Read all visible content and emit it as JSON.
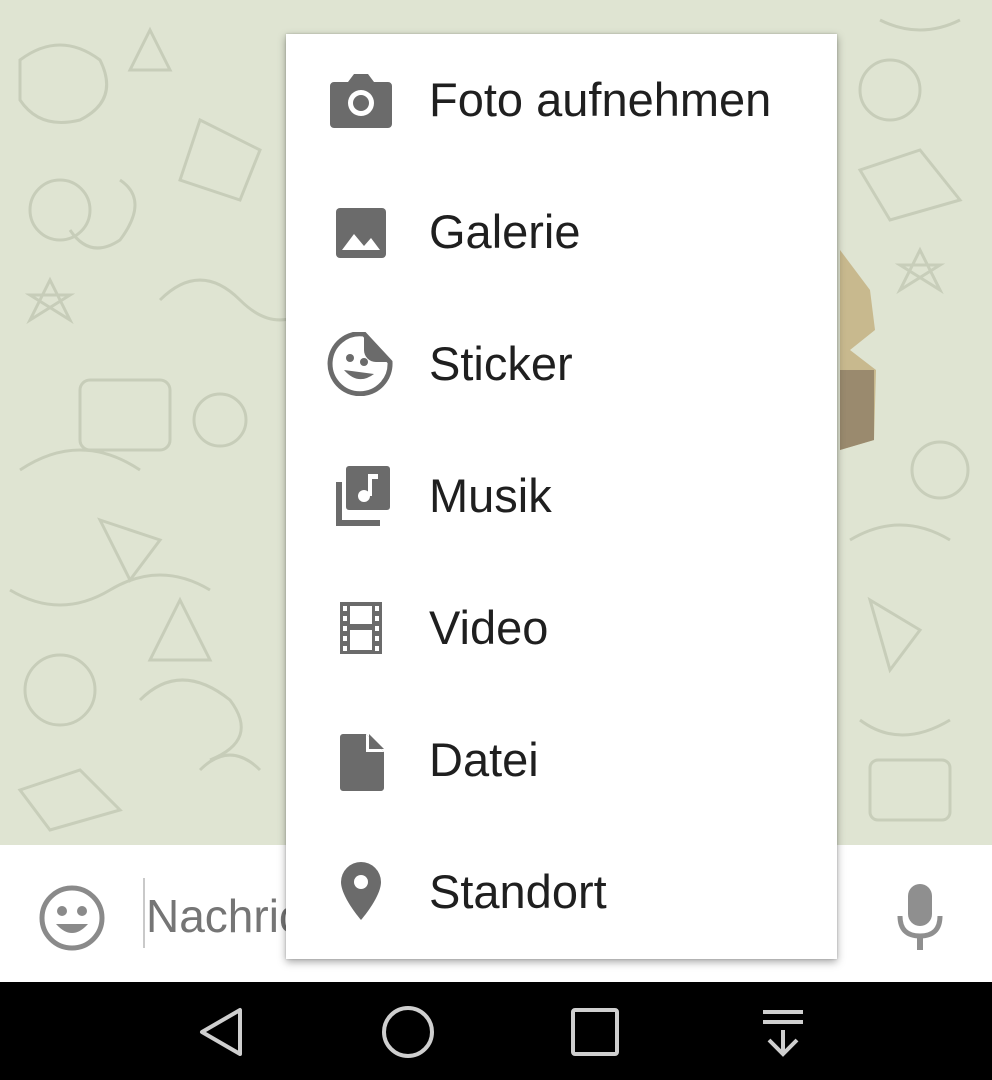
{
  "attach_menu": {
    "items": [
      {
        "label": "Foto aufnehmen",
        "icon": "camera-icon"
      },
      {
        "label": "Galerie",
        "icon": "image-icon"
      },
      {
        "label": "Sticker",
        "icon": "sticker-icon"
      },
      {
        "label": "Musik",
        "icon": "music-library-icon"
      },
      {
        "label": "Video",
        "icon": "film-icon"
      },
      {
        "label": "Datei",
        "icon": "file-icon"
      },
      {
        "label": "Standort",
        "icon": "location-pin-icon"
      }
    ]
  },
  "composer": {
    "placeholder": "Nachricht",
    "emoji_icon": "emoji-icon",
    "mic_icon": "microphone-icon"
  },
  "nav": {
    "back_icon": "back-triangle-icon",
    "home_icon": "home-circle-icon",
    "recents_icon": "recents-square-icon",
    "notifications_icon": "pull-down-icon"
  },
  "colors": {
    "chat_background": "#dfe4d2",
    "menu_background": "#ffffff",
    "icon_gray": "#6b6b6b",
    "label_text": "#1f1f1f"
  }
}
